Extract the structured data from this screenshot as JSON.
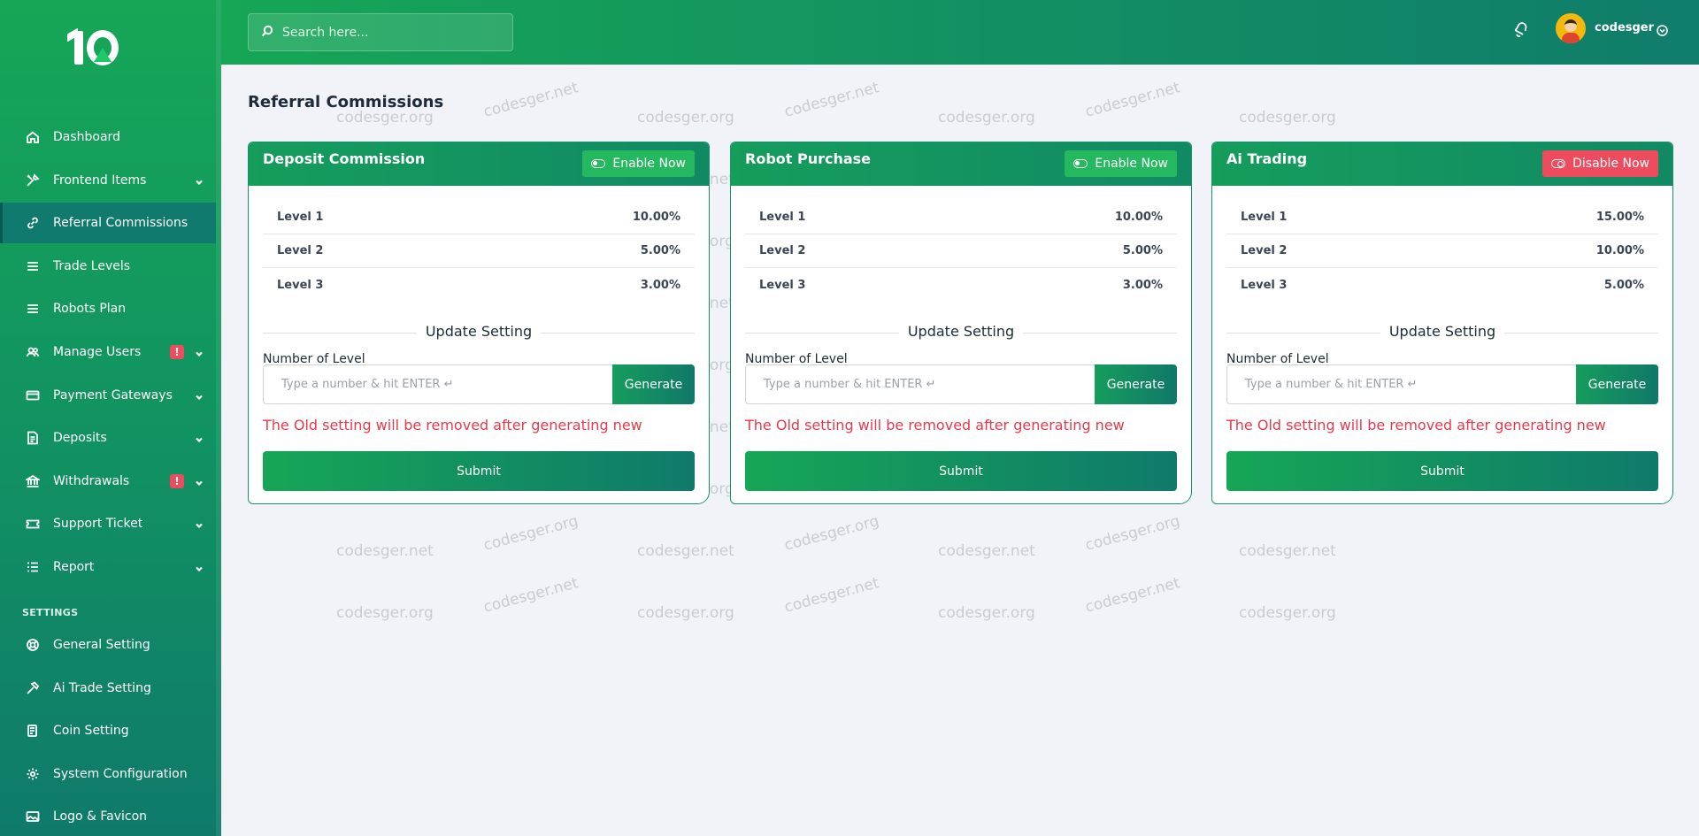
{
  "brand": {
    "logo_text": "10"
  },
  "search": {
    "placeholder": "Search here..."
  },
  "user": {
    "name": "codesger"
  },
  "sidebar": {
    "items": [
      {
        "label": "Dashboard",
        "icon": "home-icon"
      },
      {
        "label": "Frontend Items",
        "icon": "tools-icon",
        "has_chevron": true
      },
      {
        "label": "Referral Commissions",
        "icon": "link-icon",
        "active": true
      },
      {
        "label": "Trade Levels",
        "icon": "list-icon"
      },
      {
        "label": "Robots Plan",
        "icon": "list-icon"
      },
      {
        "label": "Manage Users",
        "icon": "users-icon",
        "has_chevron": true,
        "alert": "!"
      },
      {
        "label": "Payment Gateways",
        "icon": "credit-card-icon",
        "has_chevron": true
      },
      {
        "label": "Deposits",
        "icon": "document-icon",
        "has_chevron": true
      },
      {
        "label": "Withdrawals",
        "icon": "bank-icon",
        "has_chevron": true,
        "alert": "!"
      },
      {
        "label": "Support Ticket",
        "icon": "ticket-icon",
        "has_chevron": true
      },
      {
        "label": "Report",
        "icon": "report-icon",
        "has_chevron": true
      }
    ],
    "section_title": "SETTINGS",
    "settings_items": [
      {
        "label": "General Setting",
        "icon": "lifebuoy-icon"
      },
      {
        "label": "Ai Trade Setting",
        "icon": "hammer-icon"
      },
      {
        "label": "Coin Setting",
        "icon": "coins-icon"
      },
      {
        "label": "System Configuration",
        "icon": "gear-icon"
      },
      {
        "label": "Logo & Favicon",
        "icon": "image-icon"
      }
    ]
  },
  "page": {
    "title": "Referral Commissions"
  },
  "cards": [
    {
      "title": "Deposit Commission",
      "toggle_label": "Enable Now",
      "toggle_state": "enable",
      "levels": [
        {
          "label": "Level 1",
          "value": "10.00%"
        },
        {
          "label": "Level 2",
          "value": "5.00%"
        },
        {
          "label": "Level 3",
          "value": "3.00%"
        }
      ],
      "update_heading": "Update Setting",
      "number_label": "Number of Level",
      "number_placeholder": "Type a number & hit ENTER ↵",
      "generate_label": "Generate",
      "warning": "The Old setting will be removed after generating new",
      "submit_label": "Submit"
    },
    {
      "title": "Robot Purchase",
      "toggle_label": "Enable Now",
      "toggle_state": "enable",
      "levels": [
        {
          "label": "Level 1",
          "value": "10.00%"
        },
        {
          "label": "Level 2",
          "value": "5.00%"
        },
        {
          "label": "Level 3",
          "value": "3.00%"
        }
      ],
      "update_heading": "Update Setting",
      "number_label": "Number of Level",
      "number_placeholder": "Type a number & hit ENTER ↵",
      "generate_label": "Generate",
      "warning": "The Old setting will be removed after generating new",
      "submit_label": "Submit"
    },
    {
      "title": "Ai Trading",
      "toggle_label": "Disable Now",
      "toggle_state": "disable",
      "levels": [
        {
          "label": "Level 1",
          "value": "15.00%"
        },
        {
          "label": "Level 2",
          "value": "10.00%"
        },
        {
          "label": "Level 3",
          "value": "5.00%"
        }
      ],
      "update_heading": "Update Setting",
      "number_label": "Number of Level",
      "number_placeholder": "Type a number & hit ENTER ↵",
      "generate_label": "Generate",
      "warning": "The Old setting will be removed after generating new",
      "submit_label": "Submit"
    }
  ],
  "watermark": {
    "text_org": "codesger.org",
    "text_net": "codesger.net"
  },
  "colors": {
    "primary": "#16a656",
    "secondary": "#0f7a6a",
    "danger": "#ef4b5e",
    "background": "#f2f3f8"
  }
}
